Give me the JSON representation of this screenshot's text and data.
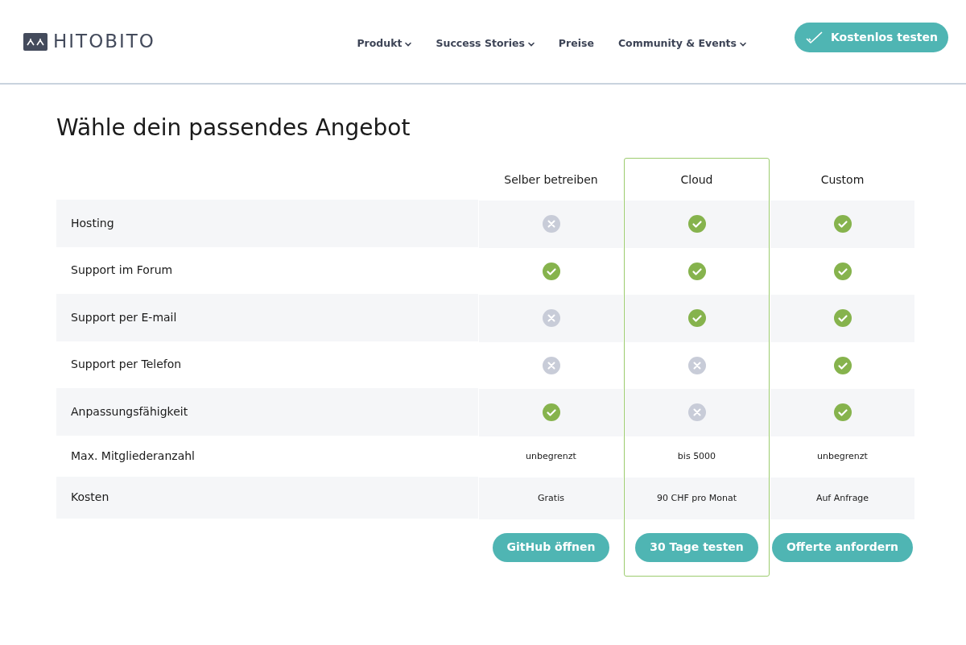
{
  "brand": "HITOBITO",
  "nav": [
    {
      "label": "Produkt",
      "dropdown": true
    },
    {
      "label": "Success Stories",
      "dropdown": true
    },
    {
      "label": "Preise",
      "dropdown": false
    },
    {
      "label": "Community & Events",
      "dropdown": true
    }
  ],
  "cta": "Kostenlos testen",
  "title": "Wähle dein passendes Angebot",
  "plans": [
    {
      "name": "Selber betreiben",
      "selected": false,
      "button": "GitHub öffnen"
    },
    {
      "name": "Cloud",
      "selected": true,
      "button": "30 Tage testen"
    },
    {
      "name": "Custom",
      "selected": false,
      "button": "Offerte anfordern"
    }
  ],
  "rows": [
    {
      "label": "Hosting",
      "kind": "mark",
      "cells": [
        {
          "included": false
        },
        {
          "included": true
        },
        {
          "included": true
        }
      ]
    },
    {
      "label": "Support im Forum",
      "kind": "mark",
      "cells": [
        {
          "included": true
        },
        {
          "included": true
        },
        {
          "included": true
        }
      ]
    },
    {
      "label": "Support per E-mail",
      "kind": "mark",
      "cells": [
        {
          "included": false
        },
        {
          "included": true
        },
        {
          "included": true
        }
      ]
    },
    {
      "label": "Support per Telefon",
      "kind": "mark",
      "cells": [
        {
          "included": false
        },
        {
          "included": false
        },
        {
          "included": true
        }
      ]
    },
    {
      "label": "Anpassungsfähigkeit",
      "kind": "mark",
      "cells": [
        {
          "included": true
        },
        {
          "included": false
        },
        {
          "included": true
        }
      ]
    },
    {
      "label": "Max. Mitgliederanzahl",
      "kind": "text",
      "cells": [
        {
          "text": "unbegrenzt"
        },
        {
          "text": "bis 5000"
        },
        {
          "text": "unbegrenzt"
        }
      ]
    },
    {
      "label": "Kosten",
      "kind": "text",
      "cells": [
        {
          "text": "Gratis"
        },
        {
          "text": "90 CHF pro Monat"
        },
        {
          "text": "Auf Anfrage"
        }
      ]
    }
  ]
}
